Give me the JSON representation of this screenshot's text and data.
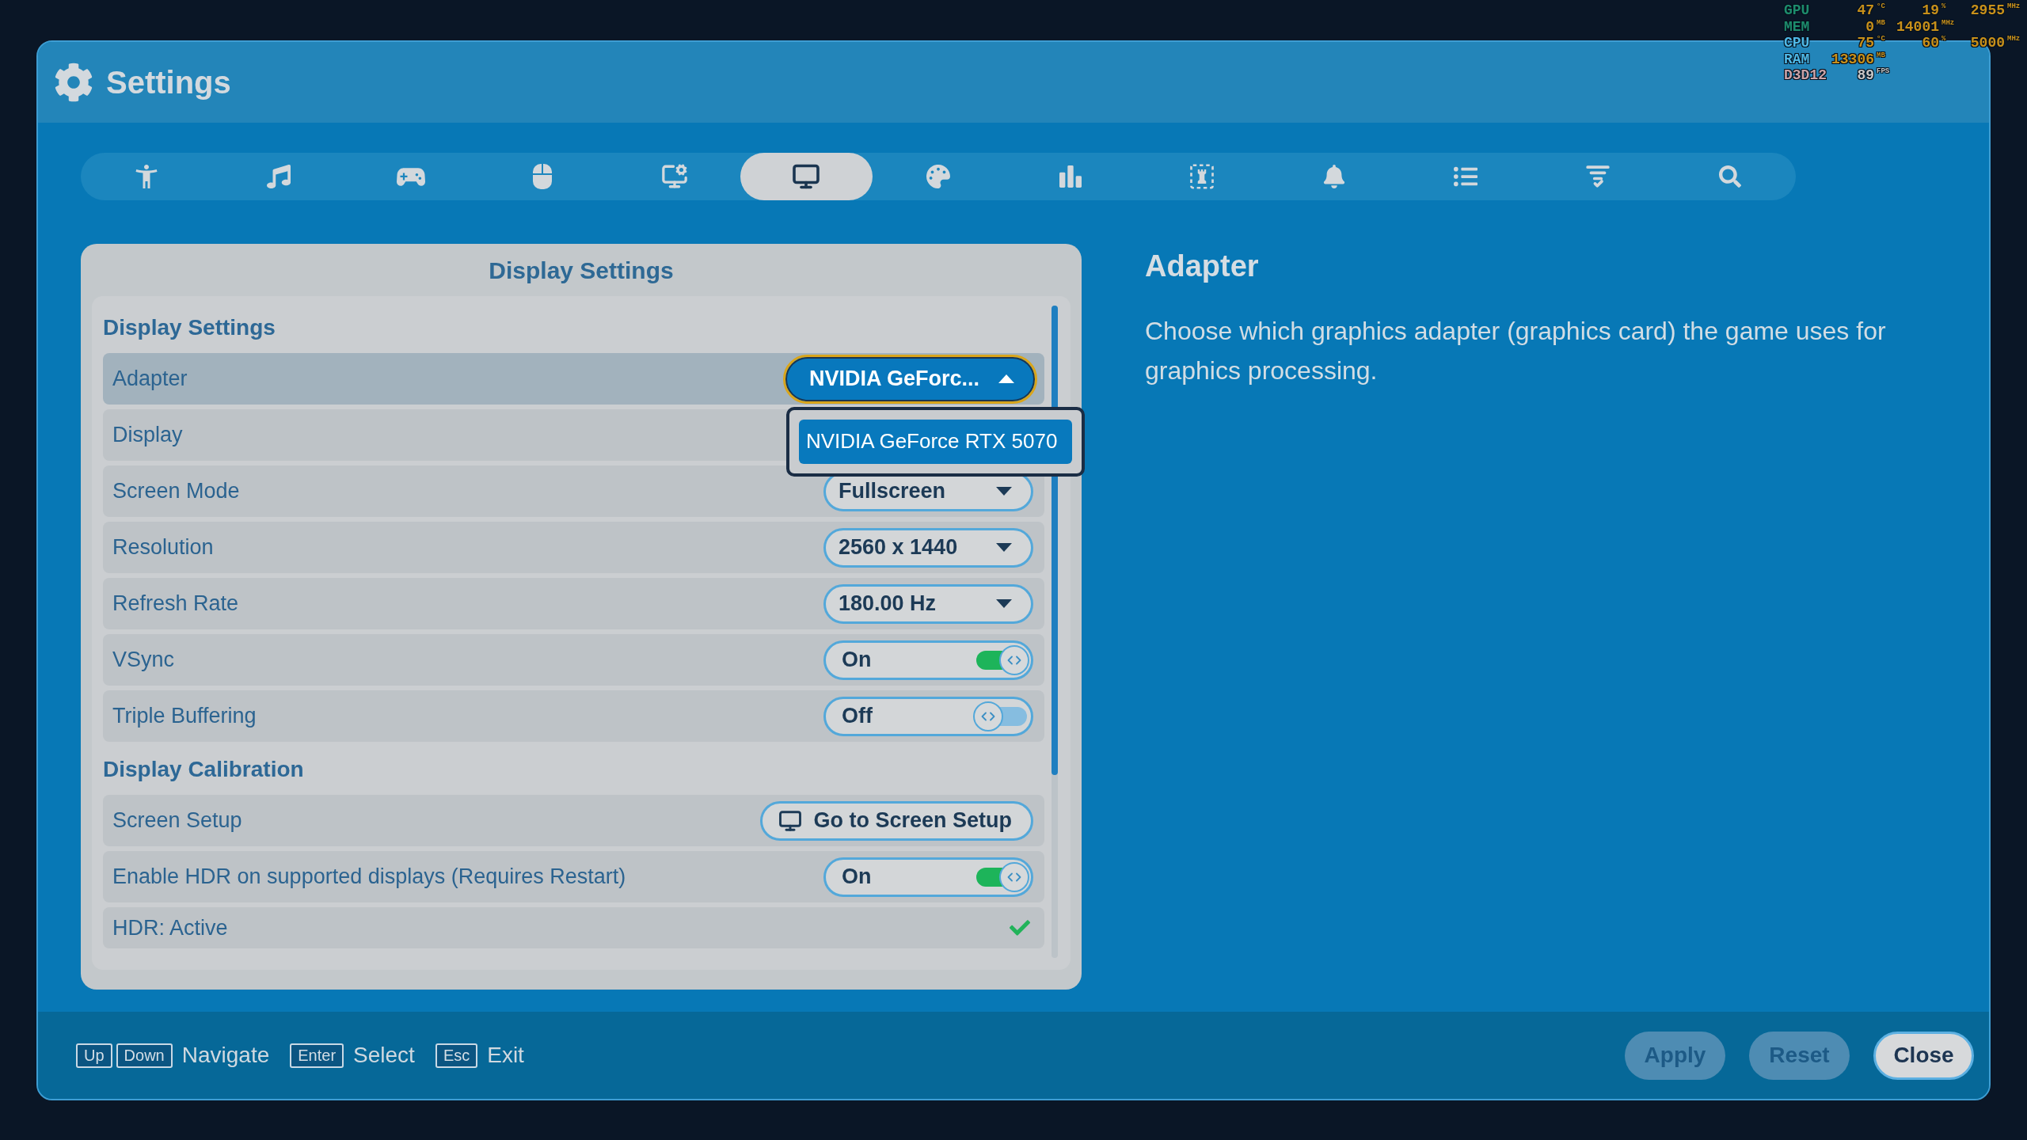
{
  "overlay": {
    "rows": [
      {
        "label": "GPU",
        "color": "#1d8c6c",
        "cells": [
          {
            "value": "47",
            "unit": "°C",
            "color": "#c8901a"
          },
          {
            "value": "19",
            "unit": "%",
            "color": "#c8901a"
          },
          {
            "value": "2955",
            "unit": "MHz",
            "color": "#c8901a"
          }
        ]
      },
      {
        "label": "MEM",
        "color": "#1d8c6c",
        "cells": [
          {
            "value": "0",
            "unit": "MB",
            "color": "#c8901a"
          },
          {
            "value": "14001",
            "unit": "MHz",
            "color": "#c8901a"
          }
        ]
      },
      {
        "label": "CPU",
        "color": "#4fb8e6",
        "cells": [
          {
            "value": "75",
            "unit": "°C",
            "color": "#c8901a"
          },
          {
            "value": "60",
            "unit": "%",
            "color": "#c8901a"
          },
          {
            "value": "5000",
            "unit": "MHz",
            "color": "#c8901a"
          }
        ]
      },
      {
        "label": "RAM",
        "color": "#4fb8e6",
        "cells": [
          {
            "value": "13306",
            "unit": "MB",
            "color": "#c8901a"
          }
        ]
      },
      {
        "label": "D3D12",
        "color": "#c9a3a8",
        "cells": [
          {
            "value": "89",
            "unit": "FPS",
            "color": "#c8c8c8"
          }
        ]
      }
    ]
  },
  "window": {
    "title": "Settings"
  },
  "tabs": [
    {
      "kind": "person",
      "selected": false
    },
    {
      "kind": "music",
      "selected": false
    },
    {
      "kind": "gamepad",
      "selected": false
    },
    {
      "kind": "mouse",
      "selected": false
    },
    {
      "kind": "monitor-gear",
      "selected": false
    },
    {
      "kind": "monitor",
      "selected": true
    },
    {
      "kind": "palette",
      "selected": false
    },
    {
      "kind": "chart",
      "selected": false
    },
    {
      "kind": "rook",
      "selected": false
    },
    {
      "kind": "bell",
      "selected": false
    },
    {
      "kind": "list",
      "selected": false
    },
    {
      "kind": "checklist",
      "selected": false
    },
    {
      "kind": "search",
      "selected": false
    }
  ],
  "panel": {
    "title": "Display Settings",
    "sections": [
      {
        "title": "Display Settings",
        "rows": [
          {
            "kind": "dropdown",
            "label": "Adapter",
            "selected": true,
            "value": "NVIDIA GeForc...",
            "expanded": true,
            "options": [
              {
                "label": "NVIDIA GeForce RTX 5070",
                "selected": true
              }
            ]
          },
          {
            "kind": "dropdown",
            "label": "Display",
            "selected": false
          },
          {
            "kind": "dropdown",
            "label": "Screen Mode",
            "selected": false,
            "value": "Fullscreen",
            "expanded": false
          },
          {
            "kind": "dropdown",
            "label": "Resolution",
            "selected": false,
            "value": "2560 x 1440",
            "expanded": false
          },
          {
            "kind": "dropdown",
            "label": "Refresh Rate",
            "selected": false,
            "value": "180.00 Hz",
            "expanded": false
          },
          {
            "kind": "toggle",
            "label": "VSync",
            "selected": false,
            "value": "On",
            "on": true
          },
          {
            "kind": "toggle",
            "label": "Triple Buffering",
            "selected": false,
            "value": "Off",
            "on": false
          }
        ]
      },
      {
        "title": "Display Calibration",
        "rows": [
          {
            "kind": "button",
            "label": "Screen Setup",
            "selected": false,
            "button": "Go to Screen Setup"
          },
          {
            "kind": "toggle",
            "label": "Enable HDR on supported displays (Requires Restart)",
            "selected": false,
            "value": "On",
            "on": true
          },
          {
            "kind": "status",
            "label": "HDR: Active",
            "selected": false,
            "checked": true
          }
        ]
      }
    ]
  },
  "detail": {
    "title": "Adapter",
    "description": "Choose which graphics adapter (graphics card) the game uses for graphics processing."
  },
  "footer": {
    "hints": [
      {
        "keys": [
          "Up",
          "Down"
        ],
        "label": "Navigate"
      },
      {
        "keys": [
          "Enter"
        ],
        "label": "Select"
      },
      {
        "keys": [
          "Esc"
        ],
        "label": "Exit"
      }
    ],
    "buttons": [
      {
        "label": "Apply",
        "disabled": true
      },
      {
        "label": "Reset",
        "disabled": true
      },
      {
        "label": "Close",
        "disabled": false
      }
    ]
  }
}
